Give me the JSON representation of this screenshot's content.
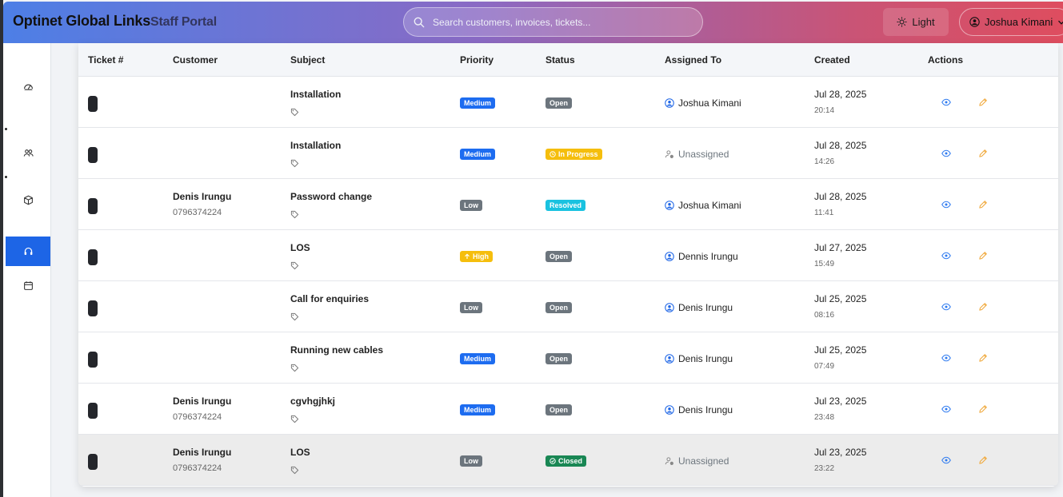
{
  "header": {
    "brand": "Optinet Global Links",
    "subtitle": "Staff Portal",
    "search_placeholder": "Search customers, invoices, tickets...",
    "theme_label": "Light",
    "user_name": "Joshua Kimani"
  },
  "sidebar": {
    "items": [
      {
        "icon": "speedometer-icon",
        "active": false
      },
      {
        "icon": "users-icon",
        "active": false
      },
      {
        "icon": "box-icon",
        "active": false
      },
      {
        "icon": "headset-icon",
        "active": true
      },
      {
        "icon": "calendar-icon",
        "active": false
      }
    ]
  },
  "table": {
    "columns": [
      "Ticket #",
      "Customer",
      "Subject",
      "Priority",
      "Status",
      "Assigned To",
      "Created",
      "Actions"
    ],
    "rows": [
      {
        "customer": "",
        "phone": "",
        "subject": "Installation",
        "priority": "Medium",
        "status": "Open",
        "assignee": "Joshua Kimani",
        "assigned": true,
        "date": "Jul 28, 2025",
        "time": "20:14"
      },
      {
        "customer": "",
        "phone": "",
        "subject": "Installation",
        "priority": "Medium",
        "status": "In Progress",
        "assignee": "Unassigned",
        "assigned": false,
        "date": "Jul 28, 2025",
        "time": "14:26"
      },
      {
        "customer": "Denis Irungu",
        "phone": "0796374224",
        "subject": "Password change",
        "priority": "Low",
        "status": "Resolved",
        "assignee": "Joshua Kimani",
        "assigned": true,
        "date": "Jul 28, 2025",
        "time": "11:41"
      },
      {
        "customer": "",
        "phone": "",
        "subject": "LOS",
        "priority": "High",
        "status": "Open",
        "assignee": "Dennis Irungu",
        "assigned": true,
        "date": "Jul 27, 2025",
        "time": "15:49"
      },
      {
        "customer": "",
        "phone": "",
        "subject": "Call for enquiries",
        "priority": "Low",
        "status": "Open",
        "assignee": "Denis Irungu",
        "assigned": true,
        "date": "Jul 25, 2025",
        "time": "08:16"
      },
      {
        "customer": "",
        "phone": "",
        "subject": "Running new cables",
        "priority": "Medium",
        "status": "Open",
        "assignee": "Denis Irungu",
        "assigned": true,
        "date": "Jul 25, 2025",
        "time": "07:49"
      },
      {
        "customer": "Denis Irungu",
        "phone": "0796374224",
        "subject": "cgvhgjhkj",
        "priority": "Medium",
        "status": "Open",
        "assignee": "Denis Irungu",
        "assigned": true,
        "date": "Jul 23, 2025",
        "time": "23:48"
      },
      {
        "customer": "Denis Irungu",
        "phone": "0796374224",
        "subject": "LOS",
        "priority": "Low",
        "status": "Closed",
        "assignee": "Unassigned",
        "assigned": false,
        "date": "Jul 23, 2025",
        "time": "23:22"
      }
    ]
  },
  "colors": {
    "primary": "#1d65e6",
    "medium": "#1d6cf0",
    "low": "#6c757d",
    "high": "#f5be0d",
    "resolved": "#19c2e0",
    "closed": "#198754",
    "view_icon": "#2f7bf0",
    "edit_icon": "#f0a83a"
  }
}
